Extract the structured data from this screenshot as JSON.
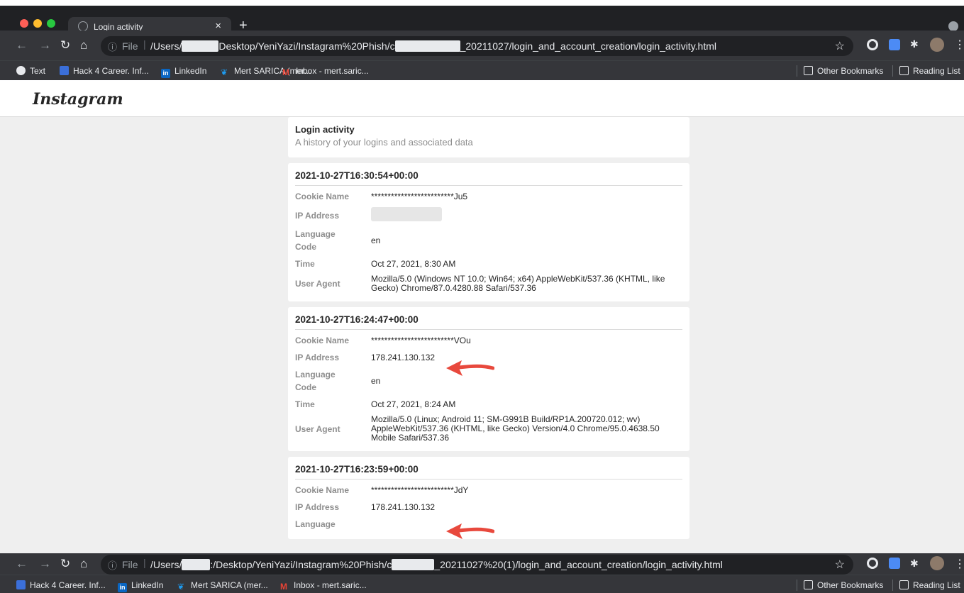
{
  "browser": {
    "tab_title": "Login activity",
    "file_label": "File",
    "top_url": {
      "pre": "/Users/",
      "mid": "Desktop/YeniYazi/Instagram%20Phish/c",
      "post": "_20211027/login_and_account_creation/login_activity.html"
    },
    "bottom_url": {
      "pre": "/Users/",
      "mid": ":/Desktop/YeniYazi/Instagram%20Phish/c",
      "post": "_20211027%20(1)/login_and_account_creation/login_activity.html"
    },
    "bookmarks_top": [
      "Text",
      "Hack 4 Career. Inf...",
      "LinkedIn",
      "Mert SARICA (mer...",
      "Inbox - mert.saric..."
    ],
    "bookmarks_bottom": [
      "Hack 4 Career. Inf...",
      "LinkedIn",
      "Mert SARICA (mer...",
      "Inbox - mert.saric..."
    ],
    "other_bookmarks": "Other Bookmarks",
    "reading_list": "Reading List"
  },
  "page": {
    "logo": "Instagram",
    "heading": "Login activity",
    "subheading": "A history of your logins and associated data",
    "labels": {
      "cookie": "Cookie Name",
      "ip": "IP Address",
      "lang": "Language Code",
      "time": "Time",
      "ua": "User Agent"
    },
    "entries": [
      {
        "timestamp": "2021-10-27T16:30:54+00:00",
        "cookie": "*************************Ju5",
        "ip": "",
        "language": "en",
        "time": "Oct 27, 2021, 8:30 AM",
        "user_agent": "Mozilla/5.0 (Windows NT 10.0; Win64; x64) AppleWebKit/537.36 (KHTML, like Gecko) Chrome/87.0.4280.88 Safari/537.36"
      },
      {
        "timestamp": "2021-10-27T16:24:47+00:00",
        "cookie": "*************************VOu",
        "ip": "178.241.130.132",
        "language": "en",
        "time": "Oct 27, 2021, 8:24 AM",
        "user_agent": "Mozilla/5.0 (Linux; Android 11; SM-G991B Build/RP1A.200720.012; wv) AppleWebKit/537.36 (KHTML, like Gecko) Version/4.0 Chrome/95.0.4638.50 Mobile Safari/537.36"
      },
      {
        "timestamp": "2021-10-27T16:23:59+00:00",
        "cookie": "*************************JdY",
        "ip": "178.241.130.132",
        "language": "Language"
      }
    ]
  },
  "colors": {
    "arrow": "#e8493d",
    "chrome_dark": "#202124",
    "chrome": "#35363a"
  }
}
